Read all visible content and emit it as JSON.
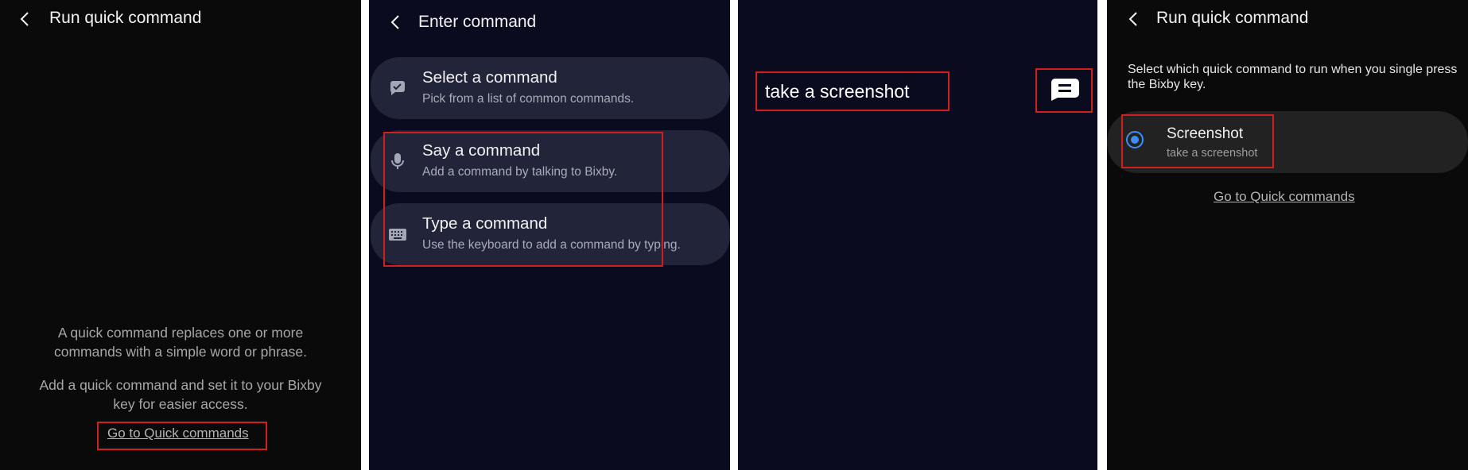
{
  "panel1": {
    "title": "Run quick command",
    "desc1": "A quick command replaces one or more commands with a simple word or phrase.",
    "desc2": "Add a quick command and set it to your Bixby key for easier access.",
    "link": "Go to Quick commands"
  },
  "panel2": {
    "title": "Enter command",
    "options": [
      {
        "label": "Select a command",
        "sub": "Pick from a list of common commands.",
        "icon": "chat-check-icon"
      },
      {
        "label": "Say a command",
        "sub": "Add a command by talking to Bixby.",
        "icon": "microphone-icon"
      },
      {
        "label": "Type a command",
        "sub": "Use the keyboard to add a command by typing.",
        "icon": "keyboard-icon"
      }
    ]
  },
  "panel3": {
    "typed_text": "take a screenshot",
    "icon": "chat-bubble-icon"
  },
  "panel4": {
    "title": "Run quick command",
    "desc": "Select which quick command to run when you single press the Bixby key.",
    "option_label": "Screenshot",
    "option_sub": "take a screenshot",
    "link": "Go to Quick commands"
  },
  "colors": {
    "highlight": "#d11f1f",
    "radio": "#3e8ef7",
    "dark_panel": "#0a0a0a",
    "navy_panel": "#0a0b1e"
  }
}
